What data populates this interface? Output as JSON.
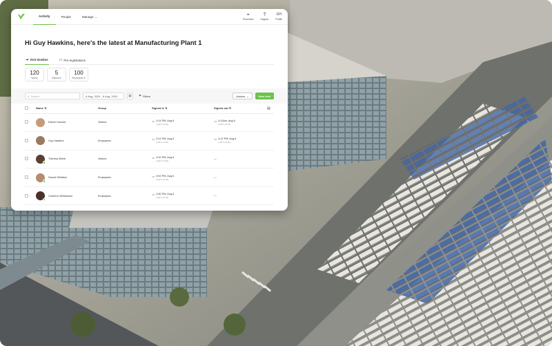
{
  "nav": {
    "items": [
      {
        "label": "Activity",
        "active": true
      },
      {
        "label": "People",
        "active": false
      },
      {
        "label": "Manage",
        "active": false,
        "chevron": true
      }
    ],
    "right": [
      {
        "icon": "pin-icon",
        "glyph": "⌖",
        "label": "Promotion"
      },
      {
        "icon": "help-icon",
        "glyph": "?",
        "label": "Support"
      },
      {
        "icon": "profile-avatar",
        "glyph": "GH",
        "label": "Profile"
      }
    ]
  },
  "heading": "Hi Guy Hawkins, here's the latest at Manufacturing Plant 1",
  "subtabs": [
    {
      "label": "Visit timeline",
      "icon": "visit-icon",
      "active": true
    },
    {
      "label": "Pre-registrations",
      "icon": "calendar-icon",
      "active": false
    }
  ],
  "stats": [
    {
      "value": "120",
      "label": "Total in"
    },
    {
      "value": "5",
      "label": "Visitors in"
    },
    {
      "value": "100",
      "label": "Employees in"
    }
  ],
  "toolbar": {
    "search_placeholder": "Search",
    "date_range": "6 Aug, 2024 - 6 Aug, 2024",
    "filters_label": "Filters",
    "actions_label": "Actions",
    "new_visit_label": "New visit"
  },
  "table": {
    "headers": {
      "name": "Name",
      "group": "Group",
      "signed_in": "Signed in",
      "signed_out": "Signed out"
    },
    "rows": [
      {
        "name": "Esther Howard",
        "group": "Visitors",
        "in_time": "3:14 PM, Aug 6",
        "in_sub": "(GMT+10:00)",
        "out_time": "4:12pm, Aug 6",
        "out_sub": "(GMT+10:00)",
        "avatar_color": "#c79a7a",
        "status_dot": false
      },
      {
        "name": "Guy Hawkins",
        "group": "Employees",
        "in_time": "3:12 PM, Aug 6",
        "in_sub": "(GMT+10:00)",
        "out_time": "4:12 PM, Aug 6",
        "out_sub": "(GMT+10:00)",
        "avatar_color": "#9b7a62",
        "status_dot": false
      },
      {
        "name": "Theresa Webb",
        "group": "Visitors",
        "in_time": "3:10 PM, Aug 6",
        "in_sub": "(GMT+10:00)",
        "out_time": "—",
        "out_sub": "",
        "avatar_color": "#5a3f33",
        "status_dot": true
      },
      {
        "name": "Darold Whitaker",
        "group": "Employees",
        "in_time": "3:00 PM, Aug 6",
        "in_sub": "(GMT+10:00)",
        "out_time": "—",
        "out_sub": "",
        "avatar_color": "#b58c6e",
        "status_dot": true
      },
      {
        "name": "Cameron Williamson",
        "group": "Employees",
        "in_time": "3:30 PM, Aug 6",
        "in_sub": "(GMT+10:00)",
        "out_time": "—",
        "out_sub": "",
        "avatar_color": "#4a3228",
        "status_dot": true
      }
    ]
  },
  "colors": {
    "accent": "#6cc24a"
  }
}
